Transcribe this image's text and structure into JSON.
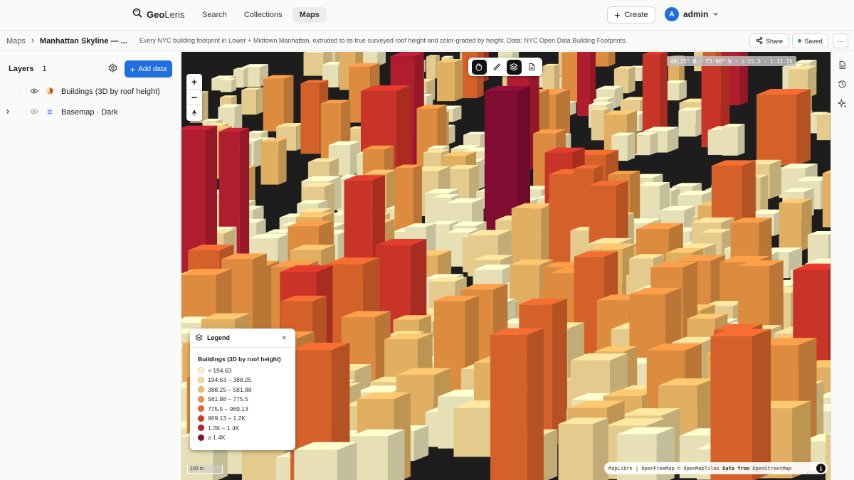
{
  "app": {
    "brand_main": "Geo",
    "brand_rest": "Lens"
  },
  "nav": [
    {
      "label": "Search"
    },
    {
      "label": "Collections"
    },
    {
      "label": "Maps"
    }
  ],
  "header": {
    "create_label": "Create",
    "user_initial": "A",
    "user_name": "admin"
  },
  "breadcrumb": {
    "root": "Maps",
    "current": "Manhattan Skyline — ...",
    "description": "Every NYC building footprint in Lower + Midtown Manhattan, extruded to its true surveyed roof height and color-graded by height. Data: NYC Open Data Building Footprints."
  },
  "actions": {
    "share_label": "Share",
    "saved_label": "Saved",
    "more_label": "···"
  },
  "sidebar": {
    "title": "Layers",
    "count": "1",
    "add_label": "Add data",
    "layers": [
      {
        "name": "Buildings (3D by roof height)"
      },
      {
        "name": "Basemap · Dark"
      }
    ]
  },
  "map": {
    "coords": "40.75° N · 73.96° W · z 15.3 · 1:11.1k",
    "scale_label": "100 m",
    "attribution_a": "MapLibre | OpenFreeMap © OpenMapTiles ",
    "attribution_b": "Data from",
    "attribution_c": " OpenStreetMap",
    "zoom_in": "+",
    "zoom_out": "−"
  },
  "legend": {
    "header": "Legend",
    "layer_title": "Buildings (3D by roof height)",
    "items": [
      {
        "label": "< 194.63",
        "color": "#fbf3c6"
      },
      {
        "label": "194.63 – 388.25",
        "color": "#f8dc98"
      },
      {
        "label": "388.25 – 581.88",
        "color": "#f4be6a"
      },
      {
        "label": "581.88 – 775.5",
        "color": "#ef9745"
      },
      {
        "label": "775.5 – 969.13",
        "color": "#e8692e"
      },
      {
        "label": "969.13 – 1.2K",
        "color": "#d9382a"
      },
      {
        "label": "1.2K – 1.4K",
        "color": "#be1f33"
      },
      {
        "label": "≥ 1.4K",
        "color": "#8c0e36"
      }
    ]
  }
}
